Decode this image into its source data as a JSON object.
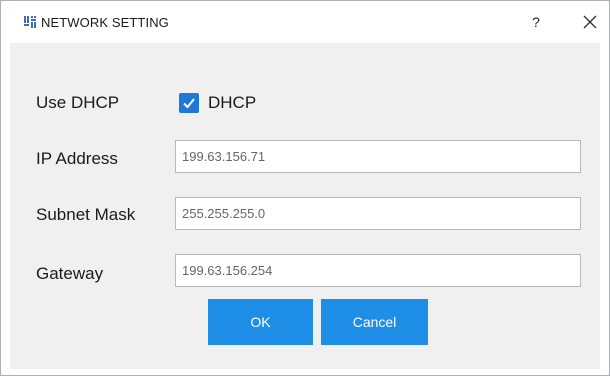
{
  "window": {
    "title": "NETWORK SETTING",
    "help_label": "?",
    "app_icon": "network-app-icon",
    "close_icon": "close-icon"
  },
  "form": {
    "dhcp": {
      "label": "Use DHCP",
      "checkbox_label": "DHCP",
      "checked": true
    },
    "ip_address": {
      "label": "IP Address",
      "value": "199.63.156.71"
    },
    "subnet_mask": {
      "label": "Subnet Mask",
      "value": "255.255.255.0"
    },
    "gateway": {
      "label": "Gateway",
      "value": "199.63.156.254"
    }
  },
  "buttons": {
    "ok_label": "OK",
    "cancel_label": "Cancel"
  },
  "colors": {
    "accent": "#1f8ee6",
    "checkbox": "#1f78d6",
    "panel_background": "#f0f0f0"
  }
}
